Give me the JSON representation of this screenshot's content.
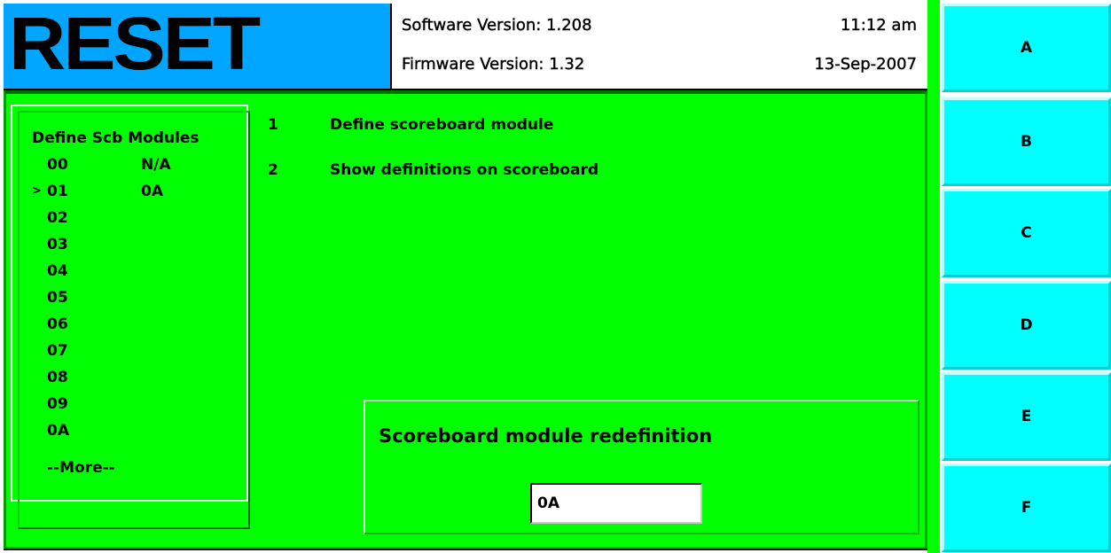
{
  "header": {
    "logo": "RESET",
    "software_version": "Software Version: 1.208",
    "firmware_version": "Firmware Version: 1.32",
    "time": "11:12 am",
    "date": "13-Sep-2007"
  },
  "module_list": {
    "title": "Define Scb Modules",
    "rows": [
      {
        "marker": "",
        "id": "00",
        "value": "N/A"
      },
      {
        "marker": ">",
        "id": "01",
        "value": "0A"
      },
      {
        "marker": "",
        "id": "02",
        "value": ""
      },
      {
        "marker": "",
        "id": "03",
        "value": ""
      },
      {
        "marker": "",
        "id": "04",
        "value": ""
      },
      {
        "marker": "",
        "id": "05",
        "value": ""
      },
      {
        "marker": "",
        "id": "06",
        "value": ""
      },
      {
        "marker": "",
        "id": "07",
        "value": ""
      },
      {
        "marker": "",
        "id": "08",
        "value": ""
      },
      {
        "marker": "",
        "id": "09",
        "value": ""
      },
      {
        "marker": "",
        "id": "0A",
        "value": ""
      }
    ],
    "more": "--More--"
  },
  "menu": [
    {
      "num": "1",
      "label": "Define scoreboard module"
    },
    {
      "num": "2",
      "label": "Show definitions on scoreboard"
    }
  ],
  "redefinition": {
    "title": "Scoreboard module redefinition",
    "value": "0A"
  },
  "side_buttons": [
    "A",
    "B",
    "C",
    "D",
    "E",
    "F"
  ],
  "colors": {
    "logo_bg": "#00a5ff",
    "panel_bg": "#00ff00",
    "button_bg": "#00ffff"
  }
}
